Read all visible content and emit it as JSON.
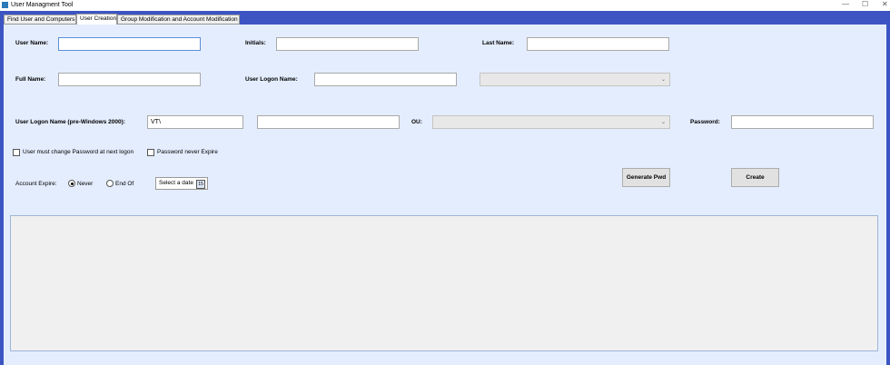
{
  "window": {
    "title": "User Managment Tool",
    "minimize": "—",
    "maximize": "☐",
    "close": "✕"
  },
  "tabs": [
    {
      "label": "Find User and Computers"
    },
    {
      "label": "User Creation"
    },
    {
      "label": "Group Modification and Account Modification"
    }
  ],
  "form": {
    "user_name": {
      "label": "User Name:",
      "value": ""
    },
    "initials": {
      "label": "Initials:",
      "value": ""
    },
    "last_name": {
      "label": "Last Name:",
      "value": ""
    },
    "full_name": {
      "label": "Full Name:",
      "value": ""
    },
    "logon_name": {
      "label": "User Logon Name:",
      "value": ""
    },
    "pre2000": {
      "label": "User Logon Name (pre-Windows 2000):",
      "domain": "VT\\",
      "value": ""
    },
    "ou": {
      "label": "OU:"
    },
    "password": {
      "label": "Password:",
      "value": ""
    },
    "must_change": {
      "label": "User must change Password at next logon",
      "checked": false
    },
    "never_expire": {
      "label": "Password never Expire",
      "checked": false
    },
    "account_expire": {
      "label": "Account Expire:",
      "never": "Never",
      "end_of": "End Of",
      "selected": "Never",
      "date_placeholder": "Select a date",
      "cal_icon_text": "15"
    }
  },
  "buttons": {
    "generate": "Generate Pwd",
    "create": "Create"
  }
}
